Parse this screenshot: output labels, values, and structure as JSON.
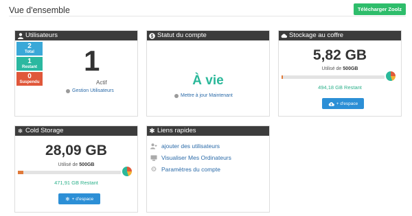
{
  "header": {
    "title": "Vue d'ensemble",
    "download_label": "Télécharger Zoolz"
  },
  "users_card": {
    "title": "Utilisateurs",
    "stats": [
      {
        "value": "2",
        "label": "Total",
        "color": "#3aa8d8"
      },
      {
        "value": "1",
        "label": "Restant",
        "color": "#2bb8a0"
      },
      {
        "value": "0",
        "label": "Suspendu",
        "color": "#e0573a"
      }
    ],
    "active_count": "1",
    "active_label": "Actif",
    "manage_link": "Gestion Utilisateurs"
  },
  "account_card": {
    "title": "Statut du compte",
    "status": "À vie",
    "upgrade_link": "Mettre à jour Maintenant"
  },
  "vault_card": {
    "title": "Stockage au coffre",
    "used": "5,82 GB",
    "used_prefix": "Utilisé de",
    "total": "500GB",
    "remaining": "494,18 GB Restant",
    "button_label": "+ d'espace",
    "fill_fraction": 0.0116
  },
  "cold_card": {
    "title": "Cold Storage",
    "used": "28,09 GB",
    "used_prefix": "Utilisé de",
    "total": "500GB",
    "remaining": "471,91 GB Restant",
    "button_label": "+ d'espace",
    "fill_fraction": 0.0562
  },
  "quick_links_card": {
    "title": "Liens rapides",
    "links": [
      {
        "label": "ajouter des utilisateurs",
        "icon": "add-user-icon"
      },
      {
        "label": "Visualiser Mes Ordinateurs",
        "icon": "computer-icon"
      },
      {
        "label": "Paramètres du compte",
        "icon": "gear-icon"
      }
    ]
  }
}
